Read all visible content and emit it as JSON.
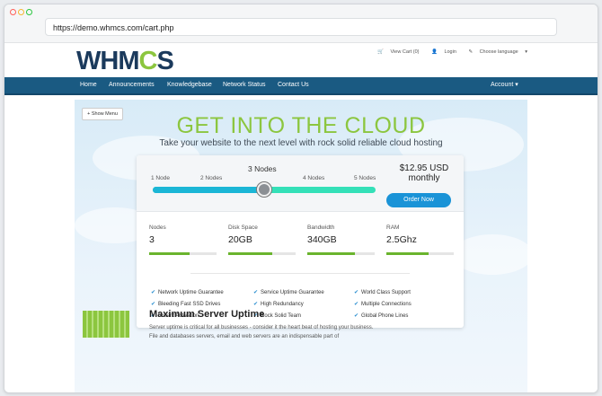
{
  "browser": {
    "url": "https://demo.whmcs.com/cart.php"
  },
  "header": {
    "logo_text": "WHMCS",
    "logo_prefix": "WHM",
    "logo_gear": "C",
    "logo_suffix": "S",
    "view_cart": "View Cart (0)",
    "login": "Login",
    "choose_language": "Choose language"
  },
  "nav": {
    "items": [
      "Home",
      "Announcements",
      "Knowledgebase",
      "Network Status",
      "Contact Us"
    ],
    "account": "Account"
  },
  "hero": {
    "show_menu": "Show Menu",
    "title": "GET INTO THE CLOUD",
    "subtitle": "Take your website to the next level with rock solid reliable cloud hosting"
  },
  "slider": {
    "labels": [
      "1 Node",
      "2 Nodes",
      "3 Nodes",
      "4 Nodes",
      "5 Nodes"
    ],
    "selected_index": 2,
    "price": "$12.95 USD",
    "period": "monthly",
    "order_button": "Order Now"
  },
  "specs": [
    {
      "name": "Nodes",
      "value": "3",
      "level": 0.6
    },
    {
      "name": "Disk Space",
      "value": "20GB",
      "level": 0.65
    },
    {
      "name": "Bandwidth",
      "value": "340GB",
      "level": 0.7
    },
    {
      "name": "RAM",
      "value": "2.5Ghz",
      "level": 0.62
    }
  ],
  "features": [
    [
      "Network Uptime Guarantee",
      "Service Uptime Guarantee",
      "World Class Support"
    ],
    [
      "Bleeding Fast SSD Drives",
      "High Redundancy",
      "Multiple Connections"
    ],
    [
      "Instant Activation",
      "Rock Solid Team",
      "Global Phone Lines"
    ]
  ],
  "feature_block": {
    "title": "Maximum Server Uptime",
    "text": "Server uptime is critical for all businesses - consider it the heart beat of hosting your business. File and databases servers, email and web servers are an indispensable part of"
  },
  "colors": {
    "accent_green": "#8cc63f",
    "nav_blue": "#1a5a82",
    "button_blue": "#1a93d7"
  }
}
